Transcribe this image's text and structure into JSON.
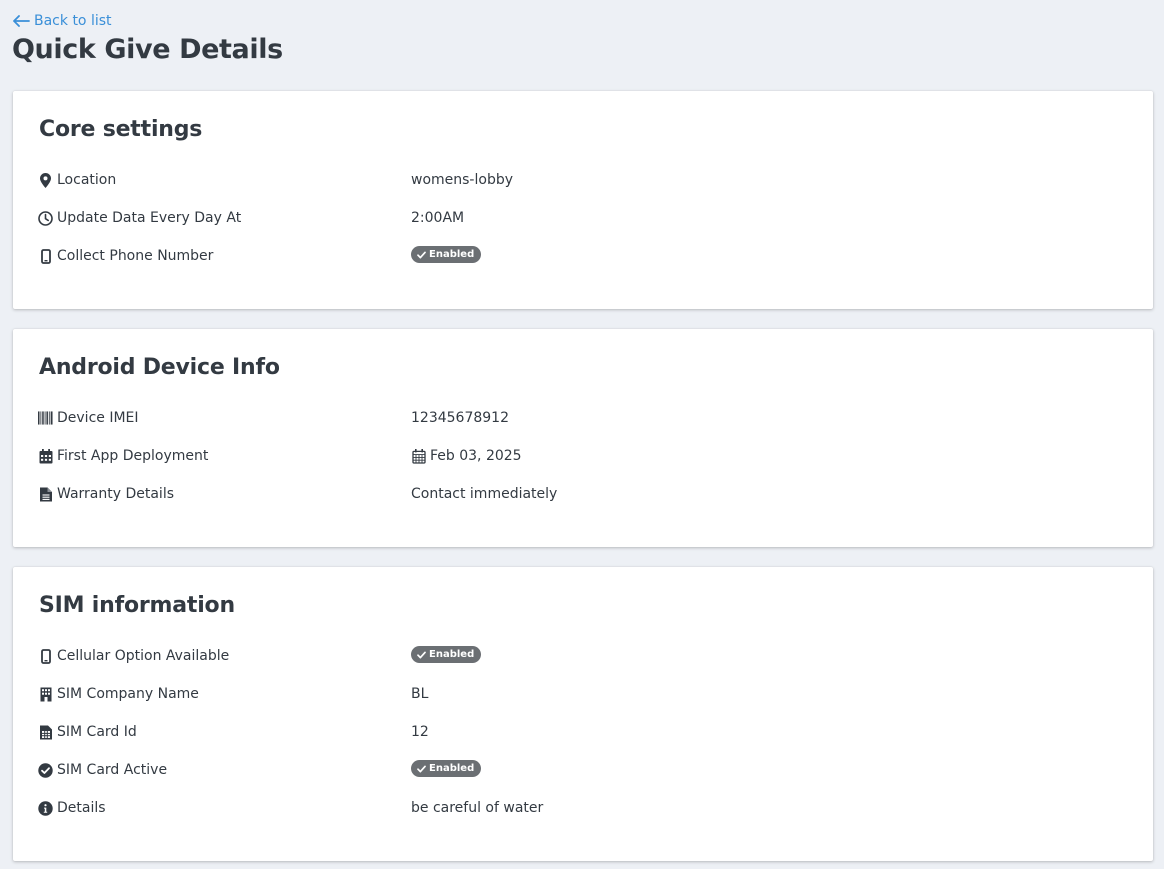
{
  "header": {
    "back_label": "Back to list",
    "title": "Quick Give Details"
  },
  "colors": {
    "link": "#3a8fd8",
    "page_bg": "#edf0f5",
    "badge_bg": "#6b6f73",
    "text": "#333a42"
  },
  "core_settings": {
    "title": "Core settings",
    "rows": [
      {
        "icon": "map-marker-icon",
        "label": "Location",
        "value": "womens-lobby"
      },
      {
        "icon": "clock-icon",
        "label": "Update Data Every Day At",
        "value": "2:00AM"
      },
      {
        "icon": "mobile-phone-icon",
        "label": "Collect Phone Number",
        "badge": "Enabled"
      }
    ]
  },
  "android_device": {
    "title": "Android Device Info",
    "rows": [
      {
        "icon": "barcode-icon",
        "label": "Device IMEI",
        "value": "12345678912"
      },
      {
        "icon": "calendar-icon",
        "label": "First App Deployment",
        "value": "Feb 03, 2025"
      },
      {
        "icon": "file-text-icon",
        "label": "Warranty Details",
        "value": "Contact immediately"
      }
    ]
  },
  "sim_info": {
    "title": "SIM information",
    "rows": [
      {
        "icon": "mobile-phone-icon",
        "label": "Cellular Option Available",
        "badge": "Enabled"
      },
      {
        "icon": "building-icon",
        "label": "SIM Company Name",
        "value": "BL"
      },
      {
        "icon": "sim-card-icon",
        "label": "SIM Card Id",
        "value": "12"
      },
      {
        "icon": "check-circle-icon",
        "label": "SIM Card Active",
        "badge": "Enabled"
      },
      {
        "icon": "info-circle-icon",
        "label": "Details",
        "value": "be careful of water"
      }
    ]
  }
}
